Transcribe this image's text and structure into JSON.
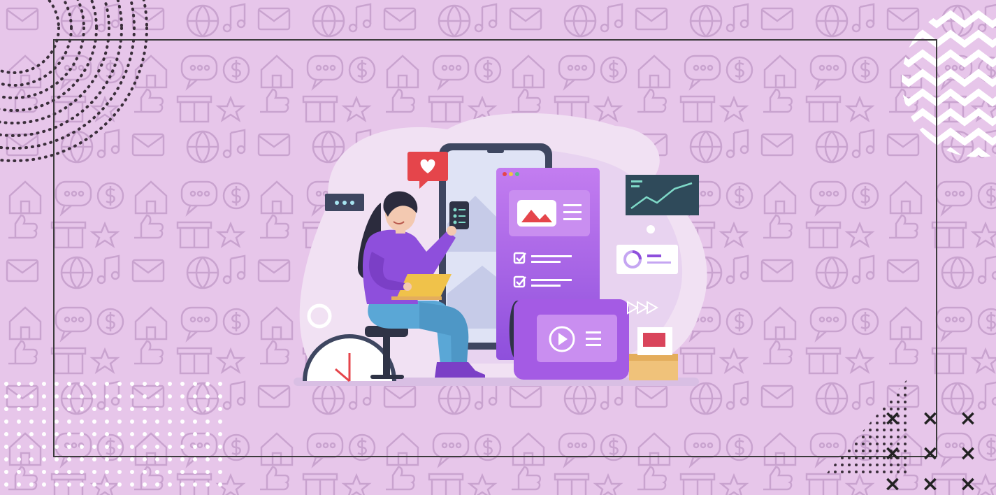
{
  "colors": {
    "background": "#e7c6ea",
    "pattern": "#c9a3cf",
    "frame": "#3b3b3b",
    "accent_purple": "#9b5de5",
    "card_purple": "#b06ae8",
    "dark_teal": "#2f4a5a",
    "heart_red": "#e5454b"
  },
  "icons": [
    "dotted-semicircle-pattern",
    "zigzag-chevron-circle",
    "white-dot-grid",
    "x-mark-grid",
    "heart-icon",
    "chat-dots-icon",
    "play-icon",
    "image-icon",
    "checkbox-icon",
    "line-chart-icon",
    "clock-icon",
    "smartphone-icon"
  ],
  "x_marks": [
    "×",
    "×",
    "×",
    "×",
    "×",
    "×",
    "×",
    "×",
    "×"
  ]
}
